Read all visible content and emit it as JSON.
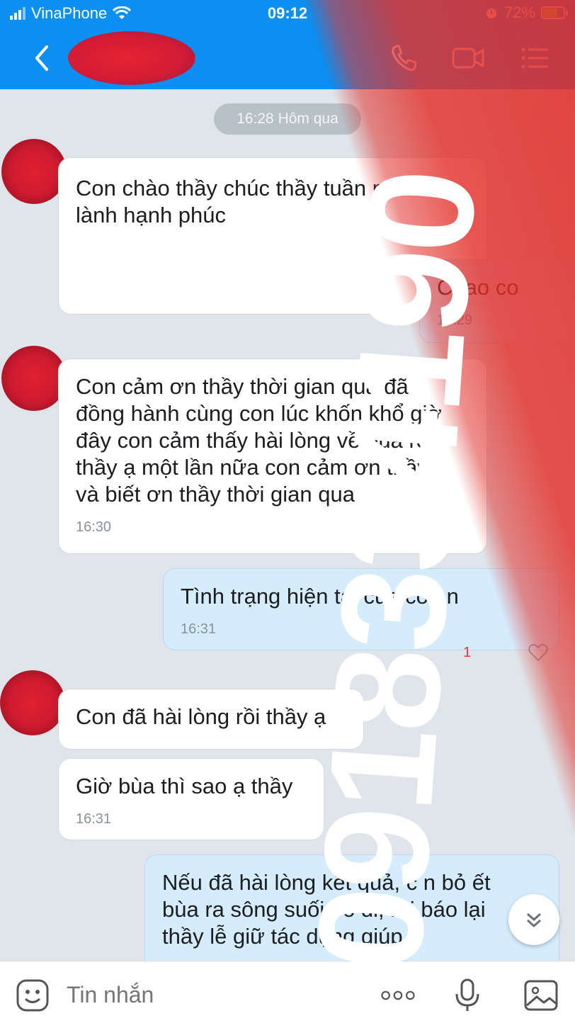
{
  "status_bar": {
    "carrier": "VinaPhone",
    "time": "09:12",
    "battery_percent": "72%",
    "battery_level": 0.72
  },
  "header": {
    "contact_name": "",
    "actions": [
      "phone-icon",
      "video-call-icon",
      "menu-icon"
    ]
  },
  "chat": {
    "date_separator": "16:28 Hôm qua",
    "messages": [
      {
        "direction": "in",
        "text": "Con chào thầy chúc thầy tuần mới an\nlành hạnh phúc",
        "time": ""
      },
      {
        "direction": "out",
        "text": "Chao co",
        "time": "16:29"
      },
      {
        "direction": "in",
        "text": "Con cảm ơn thầy thời gian qua đã\nđồng hành cùng con lúc khốn khổ giờ\nđây con cảm thấy hài lòng về bùa rồi\nthầy ạ một lần nữa con cảm ơn thầy\nvà biết ơn thầy thời gian qua",
        "time": "16:30"
      },
      {
        "direction": "out",
        "text": "Tình trạng hiện tại của con n",
        "time": "16:31"
      },
      {
        "direction": "in",
        "text": "Con đã hài lòng rồi thầy ạ",
        "time": ""
      },
      {
        "direction": "in",
        "text": "Giờ bùa thì sao ạ thầy",
        "time": "16:31"
      },
      {
        "direction": "out",
        "text": "Nếu đã hài lòng kết quả, c  n bỏ  ết\nbùa ra sông suối bỏ đi, rồi báo lại\nthầy lễ giữ tác dụng giúp",
        "time": ""
      }
    ],
    "reaction_count": "1"
  },
  "input_bar": {
    "placeholder": "Tin nhắn",
    "icons": [
      "emoji-icon",
      "more-icon",
      "microphone-icon",
      "image-icon"
    ]
  },
  "watermark": {
    "text": "0918334190"
  },
  "colors": {
    "header_blue": "#0b8ff0",
    "chat_bg": "#dfe5ea",
    "incoming_bubble": "#ffffff",
    "outgoing_bubble": "#d5ecfd",
    "watermark_red": "#e4302a"
  }
}
